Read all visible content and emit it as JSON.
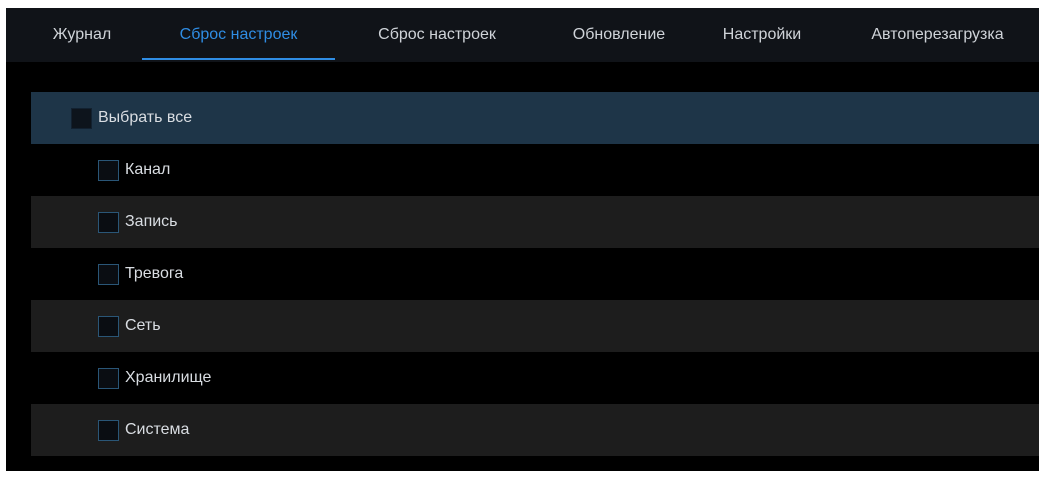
{
  "tabs": [
    {
      "label": "Журнал",
      "active": false
    },
    {
      "label": "Сброс настроек",
      "active": true
    },
    {
      "label": "Сброс настроек",
      "active": false
    },
    {
      "label": "Обновление",
      "active": false
    },
    {
      "label": "Настройки",
      "active": false
    },
    {
      "label": "Автоперезагрузка",
      "active": false
    }
  ],
  "reset_options": {
    "select_all": {
      "label": "Выбрать все",
      "checked": false
    },
    "items": [
      {
        "label": "Канал",
        "checked": false
      },
      {
        "label": "Запись",
        "checked": false
      },
      {
        "label": "Тревога",
        "checked": false
      },
      {
        "label": "Сеть",
        "checked": false
      },
      {
        "label": "Хранилище",
        "checked": false
      },
      {
        "label": "Система",
        "checked": false
      }
    ]
  },
  "colors": {
    "accent": "#2f8de4",
    "panel_background": "#000000",
    "tabbar_background": "#101318",
    "select_all_row": "#1e3548",
    "row_alt": "#1d1d1d",
    "text": "#d9dde2"
  }
}
